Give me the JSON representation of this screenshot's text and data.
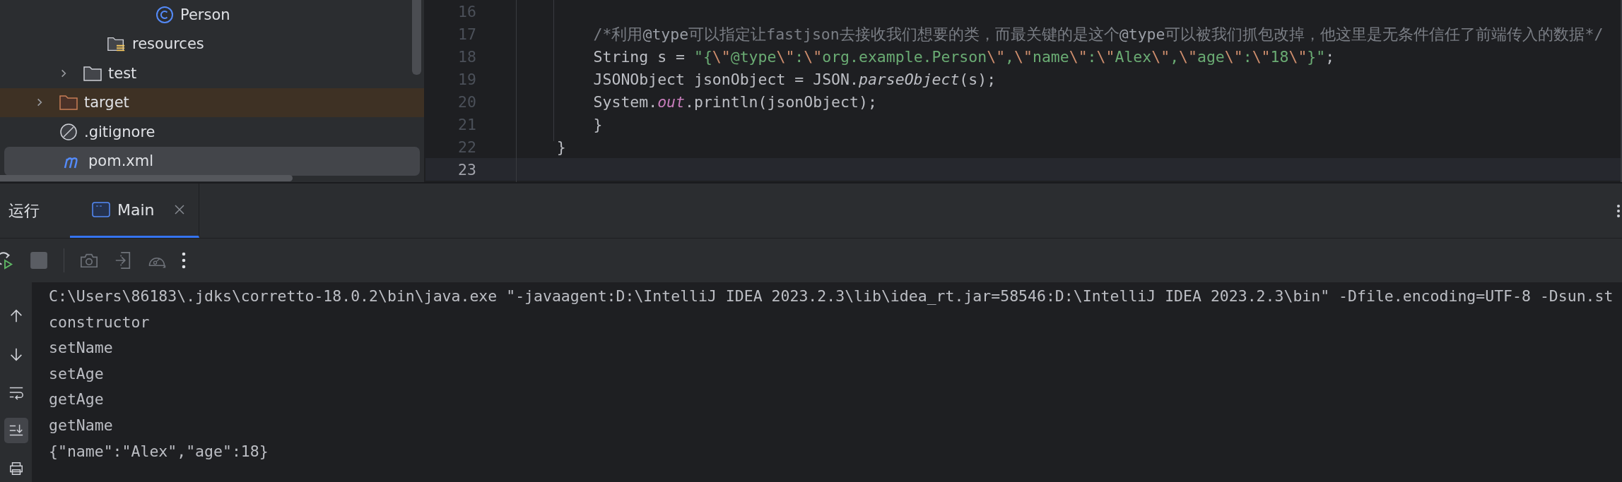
{
  "project_tree": {
    "rows": [
      {
        "children": [
          {
            "children": [
              {
                "children": [
                  {
                    "children": [
                      {
                        "label": "Person",
                        "kind": "class",
                        "selected": false
                      }
                    ]
                  }
                ]
              },
              {
                "label": "resources",
                "kind": "resource-folder",
                "selected": false
              }
            ]
          },
          {
            "label": "test",
            "kind": "folder",
            "expanded": false,
            "selected": false
          }
        ]
      },
      {
        "label": "target",
        "kind": "excluded-folder",
        "expanded": false,
        "selected": false
      },
      {
        "label": ".gitignore",
        "kind": "ignore-file",
        "selected": false
      },
      {
        "label": "pom.xml",
        "kind": "maven-file",
        "selected": true
      }
    ]
  },
  "editor": {
    "lines": [
      {
        "number": "16",
        "current": false
      },
      {
        "number": "17",
        "current": false,
        "tokens": [
          {
            "kind": "comment",
            "text": "        /*利用"
          },
          {
            "kind": "comment-tag",
            "text": "@type"
          },
          {
            "kind": "comment",
            "text": "可以指定让fastjson去接收我们想要的类，而最关键的是这个"
          },
          {
            "kind": "comment-tag",
            "text": "@type"
          },
          {
            "kind": "comment",
            "text": "可以被我们抓包改掉，他这里是无条件信任了前端传入的数据*/"
          }
        ]
      },
      {
        "number": "18",
        "current": false,
        "tokens": [
          {
            "kind": "plain",
            "text": "        String s = "
          },
          {
            "kind": "string",
            "text": "\"{"
          },
          {
            "kind": "escape",
            "text": "\\\""
          },
          {
            "kind": "string",
            "text": "@type"
          },
          {
            "kind": "escape",
            "text": "\\\""
          },
          {
            "kind": "string",
            "text": ":"
          },
          {
            "kind": "escape",
            "text": "\\\""
          },
          {
            "kind": "string",
            "text": "org.example.Person"
          },
          {
            "kind": "escape",
            "text": "\\\""
          },
          {
            "kind": "string",
            "text": ","
          },
          {
            "kind": "escape",
            "text": "\\\""
          },
          {
            "kind": "string",
            "text": "name"
          },
          {
            "kind": "escape",
            "text": "\\\""
          },
          {
            "kind": "string",
            "text": ":"
          },
          {
            "kind": "escape",
            "text": "\\\""
          },
          {
            "kind": "string",
            "text": "Alex"
          },
          {
            "kind": "escape",
            "text": "\\\""
          },
          {
            "kind": "string",
            "text": ","
          },
          {
            "kind": "escape",
            "text": "\\\""
          },
          {
            "kind": "string",
            "text": "age"
          },
          {
            "kind": "escape",
            "text": "\\\""
          },
          {
            "kind": "string",
            "text": ":"
          },
          {
            "kind": "escape",
            "text": "\\\""
          },
          {
            "kind": "string",
            "text": "18"
          },
          {
            "kind": "escape",
            "text": "\\\""
          },
          {
            "kind": "string",
            "text": "}\""
          },
          {
            "kind": "plain",
            "text": ";"
          }
        ]
      },
      {
        "number": "19",
        "current": false,
        "tokens": [
          {
            "kind": "plain",
            "text": "        JSONObject jsonObject = JSON."
          },
          {
            "kind": "static-method",
            "text": "parseObject"
          },
          {
            "kind": "plain",
            "text": "(s);"
          }
        ]
      },
      {
        "number": "20",
        "current": false,
        "tokens": [
          {
            "kind": "plain",
            "text": "        System."
          },
          {
            "kind": "static-field",
            "text": "out"
          },
          {
            "kind": "plain",
            "text": ".println(jsonObject);"
          }
        ]
      },
      {
        "number": "21",
        "current": false,
        "tokens": [
          {
            "kind": "plain",
            "text": "        }"
          }
        ]
      },
      {
        "number": "22",
        "current": false,
        "tokens": [
          {
            "kind": "plain",
            "text": "    }"
          }
        ]
      },
      {
        "number": "23",
        "current": true
      }
    ]
  },
  "run_panel": {
    "title": "运行",
    "tabs": [
      {
        "label": "Main",
        "selected": true
      }
    ],
    "run_controls": [
      {
        "kind": "rerun",
        "disabled": false
      },
      {
        "kind": "stop",
        "disabled": true
      }
    ],
    "tools": [
      {
        "kind": "screenshot",
        "disabled": true
      },
      {
        "kind": "attach",
        "disabled": true
      },
      {
        "kind": "profiler",
        "disabled": true
      },
      {
        "kind": "more",
        "disabled": false
      }
    ],
    "side_tools": [
      {
        "kind": "up",
        "on": false
      },
      {
        "kind": "down",
        "on": false
      },
      {
        "kind": "soft-wrap",
        "on": false
      },
      {
        "kind": "scroll-to-end",
        "on": true
      },
      {
        "kind": "print",
        "on": false
      }
    ],
    "output": [
      "C:\\Users\\86183\\.jdks\\corretto-18.0.2\\bin\\java.exe \"-javaagent:D:\\IntelliJ IDEA 2023.2.3\\lib\\idea_rt.jar=58546:D:\\IntelliJ IDEA 2023.2.3\\bin\" -Dfile.encoding=UTF-8 -Dsun.st",
      "constructor",
      "setName",
      "setAge",
      "getAge",
      "getName",
      "{\"name\":\"Alex\",\"age\":18}"
    ]
  }
}
